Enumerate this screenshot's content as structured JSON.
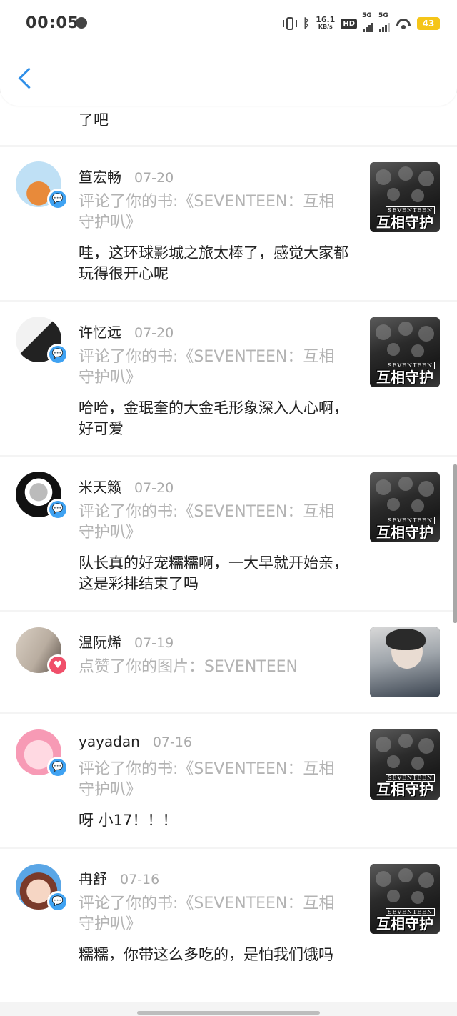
{
  "status_bar": {
    "time": "00:05",
    "net_speed_value": "16.1",
    "net_speed_unit": "KB/s",
    "hd_label": "HD",
    "sim1_label": "5G",
    "sim2_label": "5G",
    "battery": "43",
    "icons": [
      "globe-icon",
      "vibrate-icon",
      "bluetooth-icon",
      "signal-icon",
      "wifi-icon",
      "battery-icon"
    ]
  },
  "header": {
    "back_icon": "chevron-left-icon",
    "accent": "#2f8fe8"
  },
  "partial_item": {
    "comment": "了吧"
  },
  "notifications": [
    {
      "name": "笪宏畅",
      "date": "07-20",
      "badge": "comment-badge-icon",
      "action": "评论了你的书:《SEVENTEEN：互相守护叭》",
      "comment": "哇，这环球影城之旅太棒了，感觉大家都玩得很开心呢",
      "thumb_type": "book",
      "cover_label": "SEVENTEEN",
      "cover_title": "互相守护叭"
    },
    {
      "name": "许忆远",
      "date": "07-20",
      "badge": "comment-badge-icon",
      "action": "评论了你的书:《SEVENTEEN：互相守护叭》",
      "comment": "哈哈，金珉奎的大金毛形象深入人心啊，好可爱",
      "thumb_type": "book",
      "cover_label": "SEVENTEEN",
      "cover_title": "互相守护叭"
    },
    {
      "name": "米天籁",
      "date": "07-20",
      "badge": "comment-badge-icon",
      "action": "评论了你的书:《SEVENTEEN：互相守护叭》",
      "comment": "队长真的好宠糯糯啊，一大早就开始亲，这是彩排结束了吗",
      "thumb_type": "book",
      "cover_label": "SEVENTEEN",
      "cover_title": "互相守护叭"
    },
    {
      "name": "温阮烯",
      "date": "07-19",
      "badge": "heart-badge-icon",
      "action": "点赞了你的图片：SEVENTEEN",
      "comment": "",
      "thumb_type": "photo",
      "cover_label": "",
      "cover_title": ""
    },
    {
      "name": "yayadan",
      "date": "07-16",
      "badge": "comment-badge-icon",
      "action": "评论了你的书:《SEVENTEEN：互相守护叭》",
      "comment": "呀 小17！！！",
      "thumb_type": "book",
      "cover_label": "SEVENTEEN",
      "cover_title": "互相守护叭"
    },
    {
      "name": "冉舒",
      "date": "07-16",
      "badge": "comment-badge-icon",
      "action": "评论了你的书:《SEVENTEEN：互相守护叭》",
      "comment": "糯糯，你带这么多吃的，是怕我们饿吗",
      "thumb_type": "book",
      "cover_label": "SEVENTEEN",
      "cover_title": "互相守护叭"
    }
  ]
}
